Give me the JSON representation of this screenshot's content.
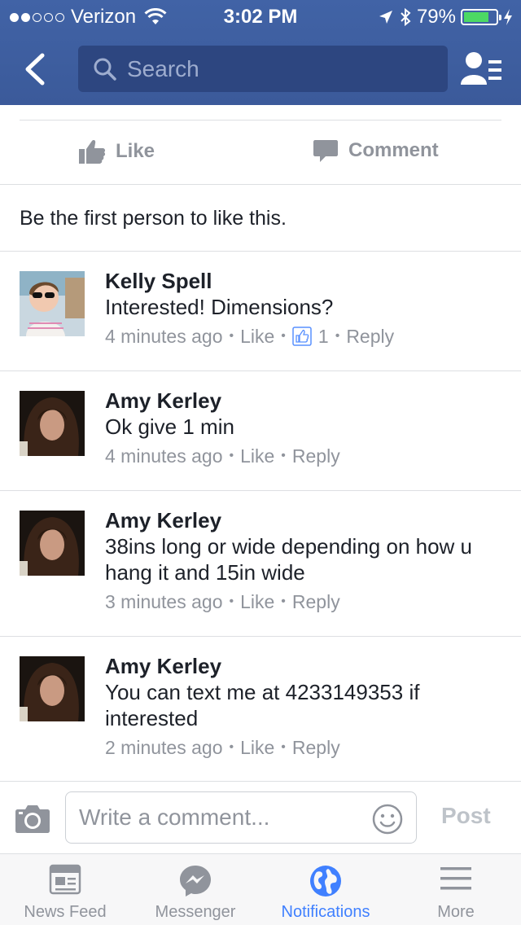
{
  "status_bar": {
    "carrier": "Verizon",
    "time": "3:02 PM",
    "battery": "79%",
    "signal_bars_filled": 2,
    "signal_bars_total": 5,
    "battery_level": 0.79
  },
  "nav": {
    "search_placeholder": "Search"
  },
  "actions": {
    "like_label": "Like",
    "comment_label": "Comment"
  },
  "likes_summary": "Be the first person to like this.",
  "comments": [
    {
      "author": "Kelly Spell",
      "text": "Interested! Dimensions?",
      "time": "4 minutes ago",
      "like_label": "Like",
      "like_count": "1",
      "reply_label": "Reply"
    },
    {
      "author": "Amy Kerley",
      "text": "Ok give 1 min",
      "time": "4 minutes ago",
      "like_label": "Like",
      "reply_label": "Reply"
    },
    {
      "author": "Amy Kerley",
      "text": "38ins long or wide depending on how u hang it and 15in wide",
      "time": "3 minutes ago",
      "like_label": "Like",
      "reply_label": "Reply"
    },
    {
      "author": "Amy Kerley",
      "text": "You can text me at 4233149353 if interested",
      "time": "2 minutes ago",
      "like_label": "Like",
      "reply_label": "Reply"
    }
  ],
  "composer": {
    "placeholder": "Write a comment...",
    "post_label": "Post"
  },
  "tabs": [
    {
      "label": "News Feed",
      "icon": "news-feed-icon",
      "active": false
    },
    {
      "label": "Messenger",
      "icon": "messenger-icon",
      "active": false
    },
    {
      "label": "Notifications",
      "icon": "globe-icon",
      "active": true
    },
    {
      "label": "More",
      "icon": "menu-icon",
      "active": false
    }
  ],
  "colors": {
    "brand_blue": "#3b5998",
    "active_tab": "#4080ff",
    "meta_gray": "#90949c",
    "battery_green": "#4cd964"
  }
}
